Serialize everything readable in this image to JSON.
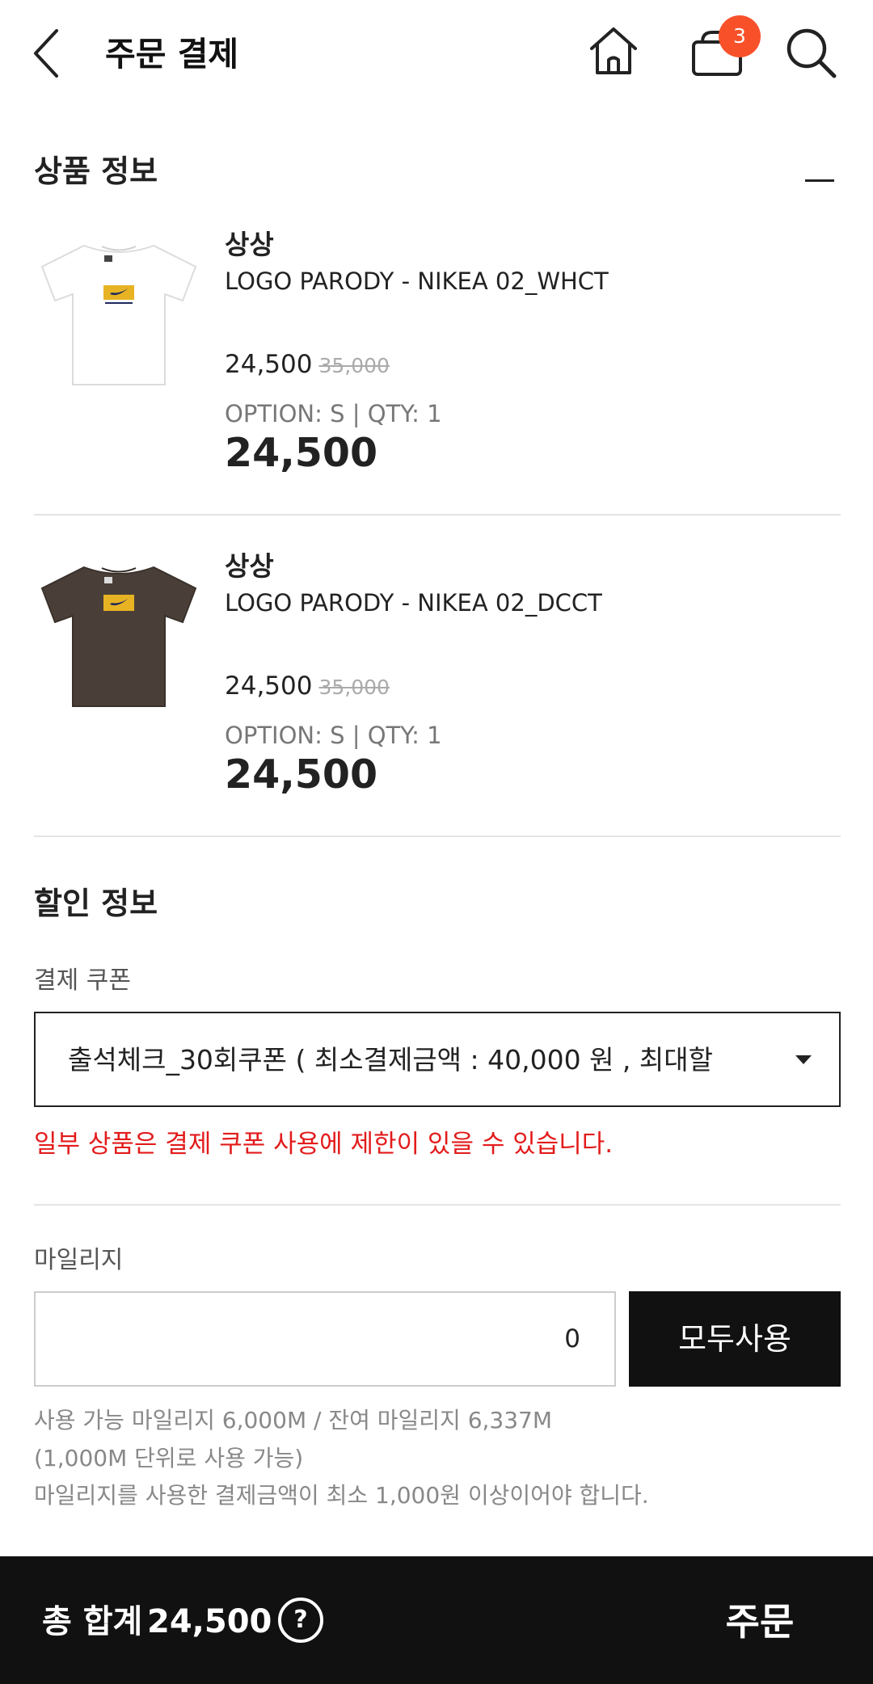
{
  "header": {
    "title": "주문 결제",
    "cart_count": "3",
    "icons": [
      "chevron-left-icon",
      "home-icon",
      "cart-icon",
      "search-icon"
    ]
  },
  "product_section": {
    "title": "상품 정보",
    "products": [
      {
        "brand": "상상",
        "name": "LOGO PARODY - NIKEA 02_WHCT",
        "price": "24,500",
        "original_price": "35,000",
        "option": "OPTION: S | QTY: 1",
        "total": "24,500",
        "shirt_color": "#ffffff"
      },
      {
        "brand": "상상",
        "name": "LOGO PARODY - NIKEA 02_DCCT",
        "price": "24,500",
        "original_price": "35,000",
        "option": "OPTION: S | QTY: 1",
        "total": "24,500",
        "shirt_color": "#4a3f38"
      }
    ]
  },
  "discount_section": {
    "title": "할인 정보",
    "coupon_label": "결제 쿠폰",
    "coupon_selected": "출석체크_30회쿠폰 ( 최소결제금액 : 40,000 원 , 최대할",
    "coupon_warning": "일부 상품은 결제 쿠폰 사용에 제한이 있을 수 있습니다.",
    "mileage_label": "마일리지",
    "mileage_value": "0",
    "use_all_label": "모두사용",
    "mileage_notes": [
      "사용 가능 마일리지 6,000M / 잔여 마일리지 6,337M",
      "(1,000M 단위로 사용 가능)",
      "마일리지를 사용한 결제금액이 최소 1,000원 이상이어야 합니다."
    ]
  },
  "footer": {
    "total_label": "총 합계",
    "total_value": "24,500",
    "help_symbol": "?",
    "order_label": "주문"
  },
  "colors": {
    "accent_badge": "#f8512a",
    "warning": "#e31b1b",
    "dark": "#111111",
    "logo_yellow": "#e8b323",
    "logo_navy": "#1f2a5a"
  }
}
